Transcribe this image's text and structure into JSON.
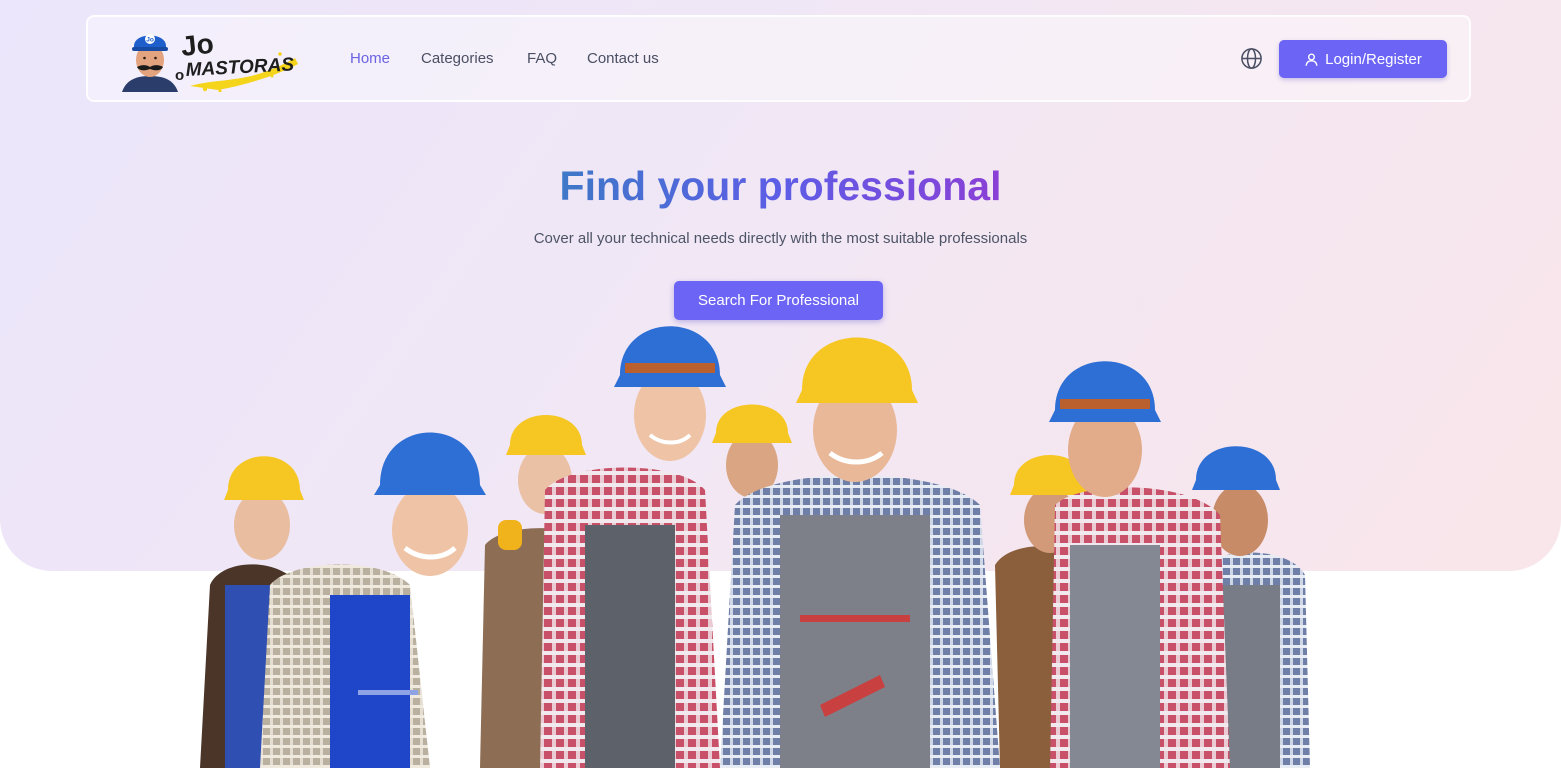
{
  "brand": {
    "logo_text_line1": "Jo",
    "logo_text_line2": "MASTORAS",
    "logo_small": "o",
    "cap_badge": "Jo"
  },
  "nav": {
    "items": [
      {
        "label": "Home",
        "active": true
      },
      {
        "label": "Categories",
        "active": false
      },
      {
        "label": "FAQ",
        "active": false
      },
      {
        "label": "Contact us",
        "active": false
      }
    ],
    "language_icon": "globe-icon",
    "login_label": "Login/Register",
    "login_icon": "user-icon"
  },
  "hero": {
    "title": "Find your professional",
    "subtitle": "Cover all your technical needs directly with the most suitable professionals",
    "cta_label": "Search For Professional"
  },
  "colors": {
    "accent": "#6c64f4",
    "active_link": "#6a63e3",
    "title_gradient": [
      "#3e78c8",
      "#5d5de6",
      "#8b3fd6"
    ]
  }
}
